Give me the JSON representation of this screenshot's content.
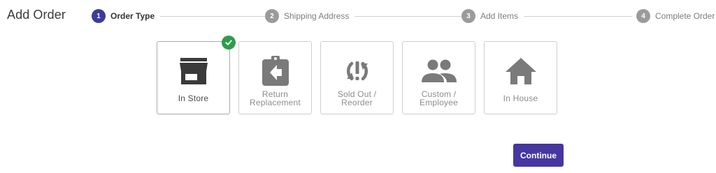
{
  "page": {
    "title": "Add Order"
  },
  "stepper": {
    "steps": [
      {
        "number": "1",
        "label": "Order Type",
        "active": true
      },
      {
        "number": "2",
        "label": "Shipping Address",
        "active": false
      },
      {
        "number": "3",
        "label": "Add Items",
        "active": false
      },
      {
        "number": "4",
        "label": "Complete Order",
        "active": false
      }
    ]
  },
  "order_types": [
    {
      "label": "In Store",
      "icon": "storefront-icon",
      "selected": true
    },
    {
      "label": "Return\nReplacement",
      "icon": "clipboard-return-icon",
      "selected": false
    },
    {
      "label": "Sold Out /\nReorder",
      "icon": "sync-alert-icon",
      "selected": false
    },
    {
      "label": "Custom /\nEmployee",
      "icon": "people-icon",
      "selected": false
    },
    {
      "label": "In House",
      "icon": "home-icon",
      "selected": false
    }
  ],
  "actions": {
    "continue_label": "Continue"
  },
  "colors": {
    "accent": "#3c3c9c",
    "button": "#4636a0",
    "selected_check": "#2e9d4a",
    "icon_selected": "#3a3a3a",
    "icon_default": "#7a7a7a"
  }
}
